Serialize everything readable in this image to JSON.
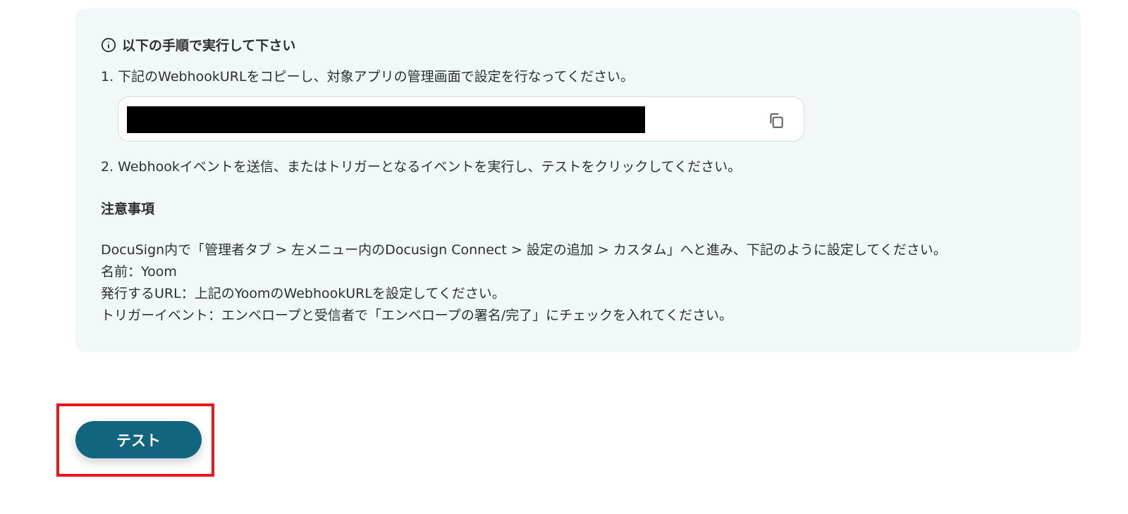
{
  "instructions": {
    "heading": "以下の手順で実行して下さい",
    "icon": "info-circle-icon",
    "step1": "1. 下記のWebhookURLをコピーし、対象アプリの管理画面で設定を行なってください。",
    "webhook_url": "",
    "copy_icon": "copy-icon",
    "step2": "2. Webhookイベントを送信、またはトリガーとなるイベントを実行し、テストをクリックしてください。"
  },
  "notes": {
    "title": "注意事項",
    "lines": [
      "DocuSign内で「管理者タブ > 左メニュー内のDocusign Connect > 設定の追加 > カスタム」へと進み、下記のように設定してください。",
      "名前：Yoom",
      "発行するURL：上記のYoomのWebhookURLを設定してください。",
      "トリガーイベント：エンベロープと受信者で「エンベロープの署名/完了」にチェックを入れてください。"
    ]
  },
  "actions": {
    "test_label": "テスト"
  },
  "colors": {
    "panel_bg": "#f2f8f7",
    "button_bg": "#11657e",
    "highlight": "#e8181c"
  }
}
